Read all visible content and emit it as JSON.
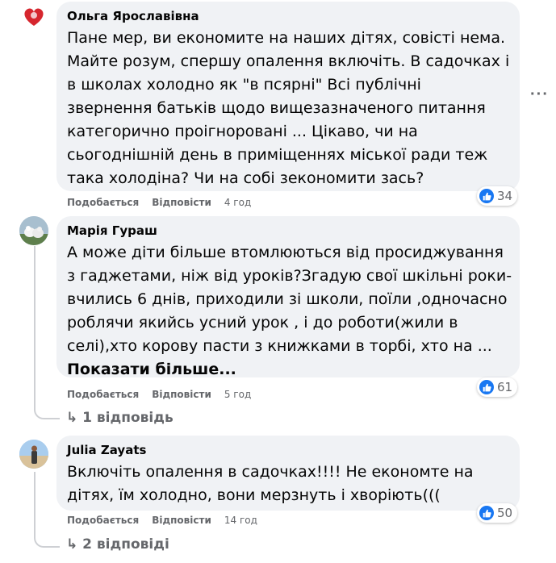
{
  "comments": [
    {
      "author": "Ольга Ярославівна",
      "lines": [
        "Пане мер, ви економите на наших дітях, совісті нема.",
        "Майте розум, спершу опалення включіть. В садочках і",
        "в школах холодно як \"в псярні\" Всі публічні",
        "звернення батьків щодо вищезазначеного питання",
        "категорично проігноровані ... Цікаво, чи на",
        "сьогоднішній день в приміщеннях міської ради теж",
        "така холодіна? Чи на собі зекономити зась?"
      ],
      "like_label": "Подобається",
      "reply_label": "Відповісти",
      "time": "4 год",
      "reactions": "34"
    },
    {
      "author": "Марія Гураш",
      "lines": [
        "А може діти більше втомлюються від просиджування",
        "з гаджетами, ніж від уроків?Згадую свої шкільні роки-",
        "вчились 6 днів, приходили зі школи, поїли ,одночасно",
        "роблячи якийсь усний урок , і до роботи(жили в",
        "селі),хто корову пасти з книжками в торбі, хто на ..."
      ],
      "see_more": "Показати більше...",
      "like_label": "Подобається",
      "reply_label": "Відповісти",
      "time": "5 год",
      "reactions": "61",
      "replies": "1 відповідь"
    },
    {
      "author": "Julia Zayats",
      "lines": [
        "Включіть опалення в садочках!!!! Не економте на",
        "дітях, їм холодно, вони мерзнуть і хворіють((("
      ],
      "like_label": "Подобається",
      "reply_label": "Відповісти",
      "time": "14 год",
      "reactions": "50",
      "replies": "2 відповіді"
    }
  ],
  "more_icon": "more-options-icon",
  "like_color": "#1877f2"
}
